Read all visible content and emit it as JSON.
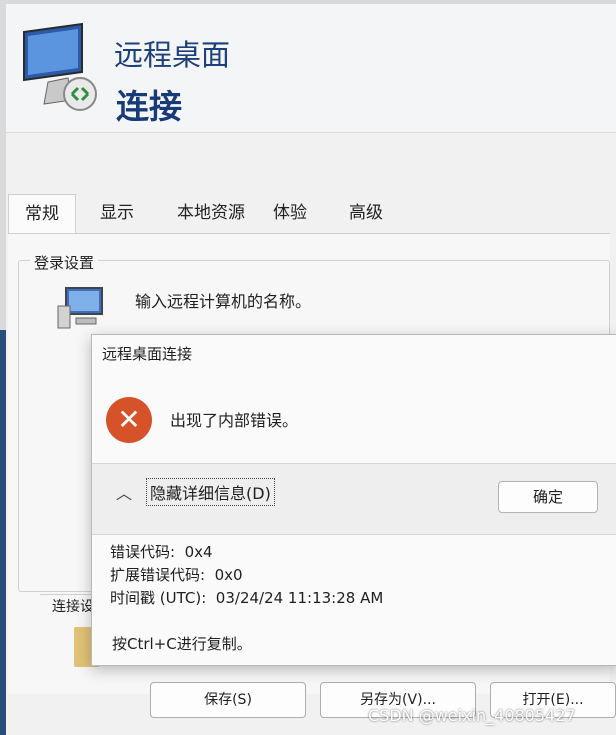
{
  "window": {
    "title": "远程桌面",
    "subtitle": "连接"
  },
  "tabs": [
    {
      "label": "常规"
    },
    {
      "label": "显示"
    },
    {
      "label": "本地资源"
    },
    {
      "label": "体验"
    },
    {
      "label": "高级"
    }
  ],
  "login_settings": {
    "title": "登录设置",
    "hint": "输入远程计算机的名称。"
  },
  "connection_settings": {
    "title": "连接设"
  },
  "bottom_buttons": {
    "save": "保存(S)",
    "save_as": "另存为(V)...",
    "open": "打开(E)..."
  },
  "error_dialog": {
    "title": "远程桌面连接",
    "message": "出现了内部错误。",
    "details_toggle": "隐藏详细信息(D)",
    "ok": "确定",
    "details": [
      "错误代码:  0x4",
      "扩展错误代码:  0x0",
      "时间戳 (UTC):  03/24/24 11:13:28 AM"
    ],
    "copy_hint": "按Ctrl+C进行复制。"
  },
  "watermark": "CSDN @weixin_40805427",
  "colors": {
    "title_blue": "#1d3f7a",
    "error_red": "#d6532a"
  }
}
